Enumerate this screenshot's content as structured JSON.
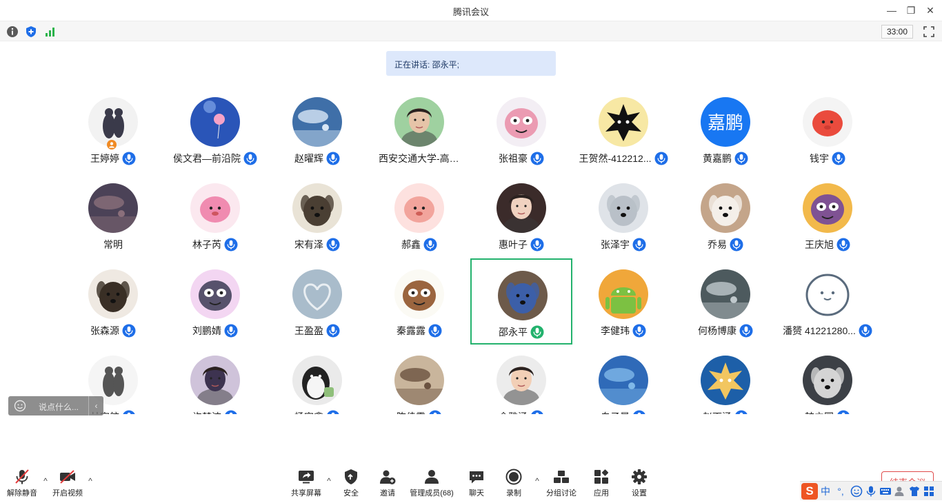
{
  "window": {
    "title": "腾讯会议",
    "minimize_glyph": "—",
    "restore_glyph": "❐",
    "close_glyph": "✕"
  },
  "infobar": {
    "timer": "33:00",
    "icons": [
      "info-icon",
      "shield-icon",
      "signal-icon",
      "fullscreen-icon"
    ]
  },
  "speaking": {
    "text": "正在讲话: 邵永平;"
  },
  "participants": [
    {
      "name": "王婷婷",
      "mic": "blue",
      "avatar": {
        "bg": "#f2f2f2",
        "fg": "#3a3a4a",
        "kind": "figure"
      },
      "badge": "orange"
    },
    {
      "name": "侯文君—前沿院",
      "mic": "blue",
      "avatar": {
        "bg": "#2a55b8",
        "fg": "#8fb3f0",
        "kind": "balloon"
      }
    },
    {
      "name": "赵曜辉",
      "mic": "blue",
      "avatar": {
        "bg": "#3f6fa8",
        "fg": "#d8e6f5",
        "kind": "sky"
      }
    },
    {
      "name": "西安交通大学-高姝君",
      "mic": "none",
      "avatar": {
        "bg": "#9fd1a0",
        "fg": "#e6c4a8",
        "kind": "face"
      }
    },
    {
      "name": "张祖豪",
      "mic": "blue",
      "avatar": {
        "bg": "#f3eef4",
        "fg": "#e98ca6",
        "kind": "cartoon"
      }
    },
    {
      "name": "王贺然-412212...",
      "mic": "blue",
      "avatar": {
        "bg": "#f7e8a4",
        "fg": "#111111",
        "kind": "star"
      }
    },
    {
      "name": "黄嘉鹏",
      "mic": "blue",
      "avatar": {
        "bg": "#1877f2",
        "fg": "#ffffff",
        "kind": "text",
        "text": "嘉鹏"
      }
    },
    {
      "name": "钱宇",
      "mic": "blue",
      "avatar": {
        "bg": "#f4f4f4",
        "fg": "#ea4b3d",
        "kind": "blob"
      }
    },
    {
      "name": "常明",
      "mic": "none",
      "avatar": {
        "bg": "#4b4257",
        "fg": "#8a6f7b",
        "kind": "sky"
      }
    },
    {
      "name": "林子芮",
      "mic": "blue",
      "avatar": {
        "bg": "#fbe8ef",
        "fg": "#f08bb0",
        "kind": "blob"
      }
    },
    {
      "name": "宋有泽",
      "mic": "blue",
      "avatar": {
        "bg": "#e9e3d6",
        "fg": "#4a3f33",
        "kind": "dog"
      }
    },
    {
      "name": "郝鑫",
      "mic": "blue",
      "avatar": {
        "bg": "#fde1df",
        "fg": "#f2a49c",
        "kind": "blob"
      }
    },
    {
      "name": "惠叶子",
      "mic": "blue",
      "avatar": {
        "bg": "#3b2b2a",
        "fg": "#f0d2c0",
        "kind": "face"
      }
    },
    {
      "name": "张泽宇",
      "mic": "blue",
      "avatar": {
        "bg": "#dfe3e8",
        "fg": "#b9c0c8",
        "kind": "dog"
      }
    },
    {
      "name": "乔易",
      "mic": "blue",
      "avatar": {
        "bg": "#c4a58a",
        "fg": "#f4efe9",
        "kind": "dog"
      }
    },
    {
      "name": "王庆旭",
      "mic": "blue",
      "avatar": {
        "bg": "#f2b94b",
        "fg": "#6b3fa0",
        "kind": "cartoon"
      }
    },
    {
      "name": "张森源",
      "mic": "blue",
      "avatar": {
        "bg": "#efe9e2",
        "fg": "#3a2f26",
        "kind": "dog"
      }
    },
    {
      "name": "刘鹏婧",
      "mic": "blue",
      "avatar": {
        "bg": "#f3d6f2",
        "fg": "#3b3b55",
        "kind": "cartoon"
      }
    },
    {
      "name": "王盈盈",
      "mic": "blue",
      "avatar": {
        "bg": "#a9bccb",
        "fg": "#e9eef2",
        "kind": "heart"
      }
    },
    {
      "name": "秦露露",
      "mic": "blue",
      "avatar": {
        "bg": "#fbfaf4",
        "fg": "#8a4a1f",
        "kind": "cartoon"
      }
    },
    {
      "name": "邵永平",
      "mic": "green",
      "active": true,
      "avatar": {
        "bg": "#6d5a4a",
        "fg": "#3c5fa8",
        "kind": "dog"
      }
    },
    {
      "name": "李健玮",
      "mic": "blue",
      "avatar": {
        "bg": "#f0a73a",
        "fg": "#7cc142",
        "kind": "android"
      }
    },
    {
      "name": "何杨博康",
      "mic": "blue",
      "avatar": {
        "bg": "#4d5a5e",
        "fg": "#bfc8cc",
        "kind": "sky"
      }
    },
    {
      "name": "潘赟 41221280...",
      "mic": "blue",
      "avatar": {
        "bg": "#ffffff",
        "fg": "#5a6b7d",
        "kind": "smiley"
      }
    },
    {
      "name": "林宇航",
      "mic": "blue",
      "avatar": {
        "bg": "#f5f5f5",
        "fg": "#555555",
        "kind": "figure"
      }
    },
    {
      "name": "许梦洁",
      "mic": "blue",
      "avatar": {
        "bg": "#cfc3da",
        "fg": "#3d3350",
        "kind": "face"
      }
    },
    {
      "name": "杨宇鑫",
      "mic": "blue",
      "avatar": {
        "bg": "#eaeaea",
        "fg": "#222222",
        "kind": "penguin"
      }
    },
    {
      "name": "陈佳雯",
      "mic": "blue",
      "avatar": {
        "bg": "#c9b59c",
        "fg": "#6b5240",
        "kind": "sky"
      }
    },
    {
      "name": "金雅涵",
      "mic": "blue",
      "avatar": {
        "bg": "#ececec",
        "fg": "#f2cfb6",
        "kind": "face"
      }
    },
    {
      "name": "白子晨",
      "mic": "blue",
      "avatar": {
        "bg": "#2f6ab8",
        "fg": "#7fb8e8",
        "kind": "sky"
      }
    },
    {
      "name": "赵雨涵",
      "mic": "blue",
      "avatar": {
        "bg": "#1d5fa8",
        "fg": "#f2c660",
        "kind": "star"
      }
    },
    {
      "name": "韩立国",
      "mic": "blue",
      "avatar": {
        "bg": "#3c4046",
        "fg": "#d4d4d4",
        "kind": "dog"
      }
    }
  ],
  "chat": {
    "placeholder": "说点什么...",
    "collapse_glyph": "‹"
  },
  "toolbar": {
    "unmute": "解除静音",
    "video": "开启视频",
    "share": "共享屏幕",
    "security": "安全",
    "invite": "邀请",
    "manage": "管理成员(68)",
    "chat": "聊天",
    "record": "录制",
    "breakout": "分组讨论",
    "apps": "应用",
    "settings": "设置",
    "end_meeting": "结束会议"
  },
  "ime": {
    "logo": "S",
    "lang": "中",
    "punct": "°,"
  },
  "colors": {
    "mic_blue": "#1e6ee8",
    "mic_green": "#23b26d",
    "active_border": "#23b26d",
    "end_red": "#e04a4a"
  }
}
